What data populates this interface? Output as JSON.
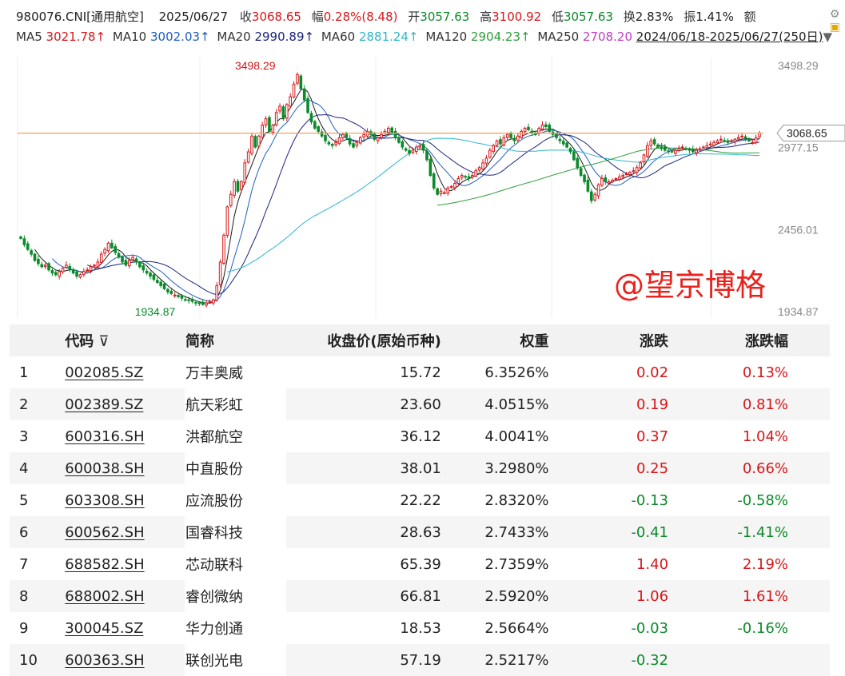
{
  "header": {
    "code": "980076.CNI[通用航空]",
    "date": "2025/06/27",
    "close_label": "收",
    "close_value": "3068.65",
    "amp_label": "幅",
    "amp_value": "0.28%(8.48)",
    "open_label": "开",
    "open_value": "3057.63",
    "high_label": "高",
    "high_value": "3100.92",
    "low_label": "低",
    "low_value": "3057.63",
    "turnover_label": "换",
    "turnover_value": "2.83%",
    "swing_label": "振",
    "swing_value": "1.41%",
    "amount_label": "额"
  },
  "ma": {
    "ma5_label": "MA5",
    "ma5": "3021.78↑",
    "ma10_label": "MA10",
    "ma10": "3002.03↑",
    "ma20_label": "MA20",
    "ma20": "2990.89↑",
    "ma60_label": "MA60",
    "ma60": "2881.24↑",
    "ma120_label": "MA120",
    "ma120": "2904.23↑",
    "ma250_label": "MA250",
    "ma250": "2708.20",
    "range": "2024/06/18-2025/06/27(250日)"
  },
  "colors": {
    "up": "#d8161a",
    "down": "#0b8a2a",
    "ma5": "#1b1b1b",
    "ma10": "#1f5fbf",
    "ma20": "#1a237e",
    "ma60": "#2bb8c8",
    "ma120": "#2e9e3a",
    "ma250": "#c040c0",
    "price_line": "#f0a060"
  },
  "chart_data": {
    "type": "candlestick",
    "y_ticks": [
      "3498.29",
      "2977.15",
      "2456.01",
      "1934.87"
    ],
    "current_price_tag": "3068.65",
    "max_label": "3498.29",
    "min_label": "1934.87",
    "ylim": [
      1934.87,
      3498.29
    ],
    "closes": [
      2400,
      2360,
      2330,
      2300,
      2260,
      2240,
      2220,
      2230,
      2200,
      2180,
      2170,
      2190,
      2210,
      2230,
      2200,
      2180,
      2160,
      2170,
      2190,
      2200,
      2220,
      2230,
      2250,
      2300,
      2330,
      2370,
      2340,
      2310,
      2280,
      2250,
      2230,
      2260,
      2280,
      2250,
      2220,
      2200,
      2180,
      2160,
      2140,
      2120,
      2100,
      2080,
      2060,
      2050,
      2040,
      2030,
      2020,
      2010,
      2005,
      2000,
      1990,
      1985,
      1980,
      1990,
      2000,
      2010,
      2100,
      2250,
      2420,
      2600,
      2680,
      2760,
      2700,
      2760,
      2880,
      2950,
      3050,
      2980,
      3050,
      3120,
      3160,
      3080,
      3120,
      3200,
      3240,
      3160,
      3250,
      3300,
      3380,
      3440,
      3350,
      3280,
      3200,
      3140,
      3100,
      3080,
      3050,
      3020,
      3000,
      2990,
      3010,
      3040,
      3060,
      3040,
      3000,
      2980,
      3010,
      3040,
      3060,
      3080,
      3060,
      3030,
      3040,
      3060,
      3080,
      3100,
      3070,
      3040,
      3010,
      2980,
      2960,
      2940,
      2960,
      2980,
      2990,
      2960,
      2900,
      2800,
      2720,
      2680,
      2700,
      2690,
      2720,
      2730,
      2750,
      2780,
      2800,
      2790,
      2780,
      2800,
      2830,
      2850,
      2880,
      2910,
      2960,
      2990,
      3020,
      3000,
      3040,
      3060,
      3040,
      3020,
      3050,
      3080,
      3100,
      3090,
      3070,
      3060,
      3100,
      3120,
      3110,
      3080,
      3060,
      3040,
      3020,
      3000,
      2980,
      2950,
      2900,
      2850,
      2800,
      2760,
      2700,
      2640,
      2680,
      2740,
      2780,
      2760,
      2760,
      2770,
      2780,
      2790,
      2800,
      2810,
      2820,
      2830,
      2850,
      2880,
      2930,
      2990,
      3020,
      3000,
      2980,
      2970,
      2960,
      2950,
      2950,
      2960,
      2970,
      2980,
      2970,
      2960,
      2950,
      2960,
      2970,
      2980,
      2990,
      3000,
      3010,
      3020,
      3030,
      3020,
      3010,
      3020,
      3030,
      3040,
      3050,
      3030,
      3020,
      3010,
      3040,
      3068.65
    ]
  },
  "watermark": "@望京博格",
  "table": {
    "headers": [
      "",
      "代码",
      "简称",
      "收盘价(原始币种)",
      "权重",
      "涨跌",
      "涨跌幅"
    ],
    "filter_icon": "⊽",
    "rows": [
      {
        "idx": "1",
        "code": "002085.SZ",
        "name": "万丰奥威",
        "close": "15.72",
        "weight": "6.3526%",
        "chg": "0.02",
        "pct": "0.13%",
        "dir": "up"
      },
      {
        "idx": "2",
        "code": "002389.SZ",
        "name": "航天彩虹",
        "close": "23.60",
        "weight": "4.0515%",
        "chg": "0.19",
        "pct": "0.81%",
        "dir": "up"
      },
      {
        "idx": "3",
        "code": "600316.SH",
        "name": "洪都航空",
        "close": "36.12",
        "weight": "4.0041%",
        "chg": "0.37",
        "pct": "1.04%",
        "dir": "up"
      },
      {
        "idx": "4",
        "code": "600038.SH",
        "name": "中直股份",
        "close": "38.01",
        "weight": "3.2980%",
        "chg": "0.25",
        "pct": "0.66%",
        "dir": "up"
      },
      {
        "idx": "5",
        "code": "603308.SH",
        "name": "应流股份",
        "close": "22.22",
        "weight": "2.8320%",
        "chg": "-0.13",
        "pct": "-0.58%",
        "dir": "down"
      },
      {
        "idx": "6",
        "code": "600562.SH",
        "name": "国睿科技",
        "close": "28.63",
        "weight": "2.7433%",
        "chg": "-0.41",
        "pct": "-1.41%",
        "dir": "down"
      },
      {
        "idx": "7",
        "code": "688582.SH",
        "name": "芯动联科",
        "close": "65.39",
        "weight": "2.7359%",
        "chg": "1.40",
        "pct": "2.19%",
        "dir": "up"
      },
      {
        "idx": "8",
        "code": "688002.SH",
        "name": "睿创微纳",
        "close": "66.81",
        "weight": "2.5920%",
        "chg": "1.06",
        "pct": "1.61%",
        "dir": "up"
      },
      {
        "idx": "9",
        "code": "300045.SZ",
        "name": "华力创通",
        "close": "18.53",
        "weight": "2.5664%",
        "chg": "-0.03",
        "pct": "-0.16%",
        "dir": "down"
      },
      {
        "idx": "10",
        "code": "600363.SH",
        "name": "联创光电",
        "close": "57.19",
        "weight": "2.5217%",
        "chg": "-0.32",
        "pct": "",
        "dir": "down"
      }
    ]
  }
}
